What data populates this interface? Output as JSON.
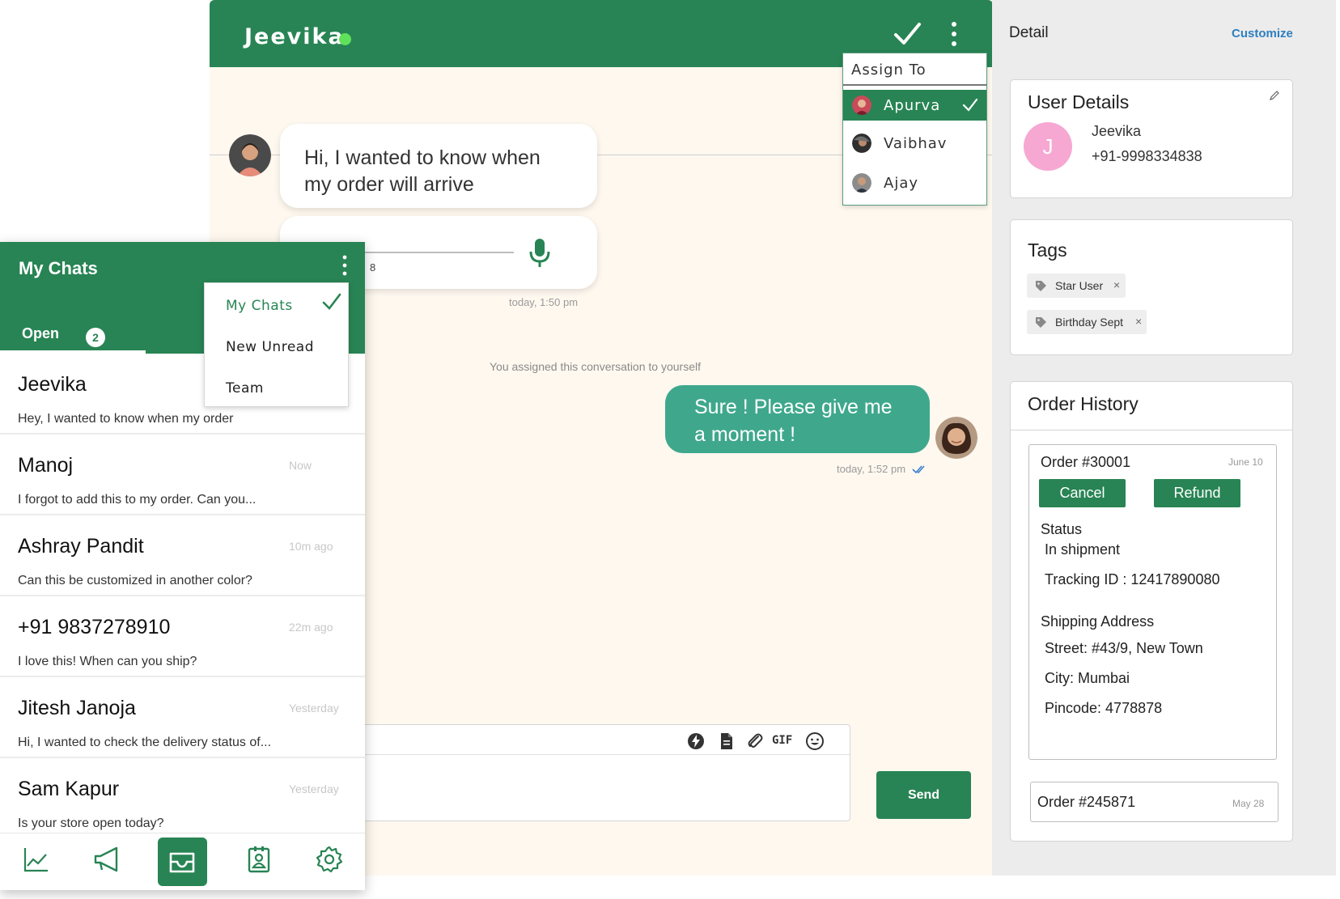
{
  "chat": {
    "contact_name": "Jeevika",
    "messages": {
      "incoming_text": "Hi, I wanted to know when my order will arrive",
      "audio_duration_fragment": "8",
      "incoming_time": "today, 1:50 pm",
      "system_note": "You assigned this conversation to yourself",
      "outgoing_text": "Sure ! Please give me a moment !",
      "outgoing_time": "today, 1:52 pm"
    },
    "composer": {
      "tools": [
        "quick-reply-icon",
        "document-icon",
        "attachment-icon",
        "gif-icon",
        "emoji-icon"
      ],
      "gif_label": "GIF",
      "send_label": "Send"
    },
    "assign_menu": {
      "title": "Assign To",
      "agents": [
        {
          "name": "Apurva",
          "selected": true
        },
        {
          "name": "Vaibhav",
          "selected": false
        },
        {
          "name": "Ajay",
          "selected": false
        }
      ]
    },
    "colors": {
      "brand": "#288454",
      "outgoing_bubble": "#3fa88c",
      "online": "#5fe15a",
      "background": "#fef8ef"
    }
  },
  "detail": {
    "title": "Detail",
    "customize_label": "Customize",
    "user": {
      "title": "User Details",
      "initial": "J",
      "name": "Jeevika",
      "phone": "+91-9998334838"
    },
    "tags": {
      "title": "Tags",
      "items": [
        "Star User",
        "Birthday Sept"
      ],
      "remove_glyph": "×"
    },
    "orders": {
      "title": "Order History",
      "list": [
        {
          "id": "Order #30001",
          "date": "June 10",
          "cancel_label": "Cancel",
          "refund_label": "Refund",
          "status_label": "Status",
          "status_value": "In shipment",
          "tracking": "Tracking ID : 12417890080",
          "address_label": "Shipping Address",
          "street": "Street: #43/9, New Town",
          "city": "City: Mumbai",
          "pincode": "Pincode: 4778878"
        },
        {
          "id": "Order #245871",
          "date": "May 28"
        }
      ]
    }
  },
  "my_chats": {
    "title": "My Chats",
    "tab_label": "Open",
    "tab_count": "2",
    "filter_menu": [
      "My Chats",
      "New Unread",
      "Team"
    ],
    "selected_filter": "My Chats",
    "conversations": [
      {
        "name": "Jeevika",
        "time": "",
        "preview": "Hey, I wanted to know when my order"
      },
      {
        "name": "Manoj",
        "time": "Now",
        "preview": "I forgot to add this to my order. Can you..."
      },
      {
        "name": "Ashray Pandit",
        "time": "10m ago",
        "preview": "Can this be customized in another color?"
      },
      {
        "name": "+91 9837278910",
        "time": "22m ago",
        "preview": "I love this! When can you ship?"
      },
      {
        "name": "Jitesh Janoja",
        "time": "Yesterday",
        "preview": "Hi, I wanted to check the delivery status of..."
      },
      {
        "name": "Sam Kapur",
        "time": "Yesterday",
        "preview": "Is your store open today?"
      }
    ],
    "bottom_nav": [
      "analytics-icon",
      "broadcast-icon",
      "inbox-icon",
      "contacts-icon",
      "settings-icon"
    ],
    "active_nav": "inbox-icon"
  }
}
